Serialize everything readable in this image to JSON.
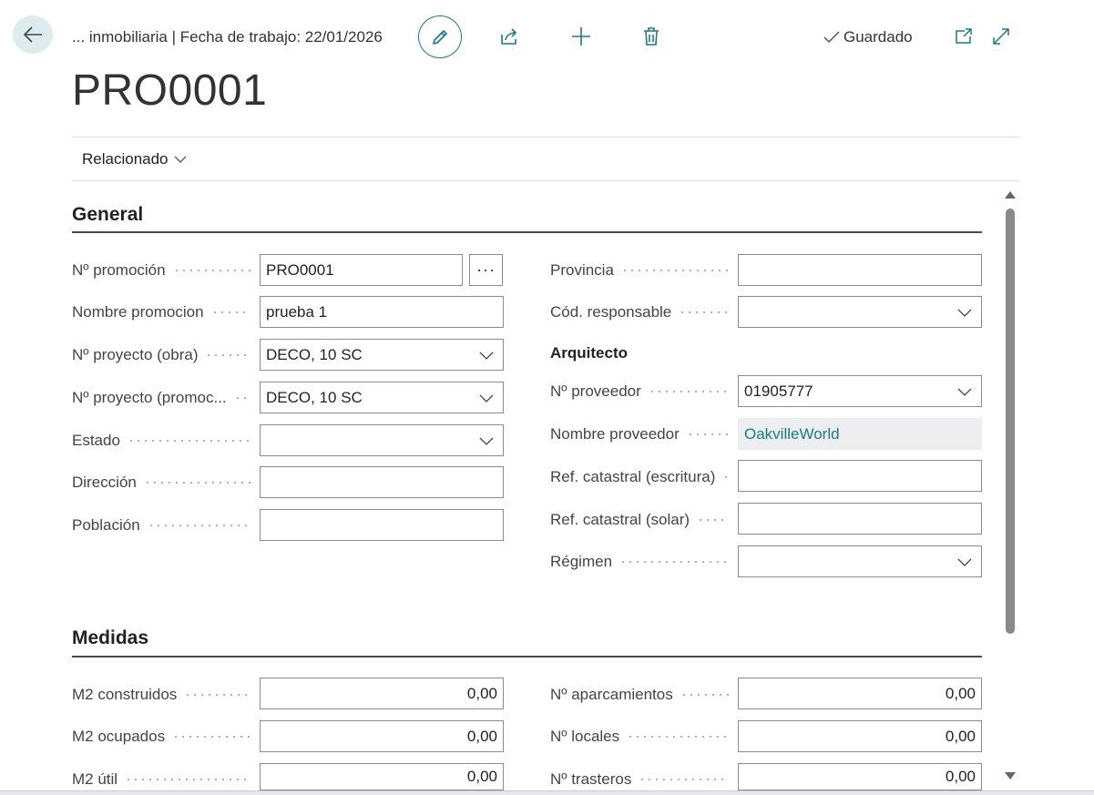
{
  "header": {
    "breadcrumb": "... inmobiliaria | Fecha de trabajo: 22/01/2026",
    "saved_status": "Guardado",
    "title": "PRO0001"
  },
  "nav": {
    "related_label": "Relacionado"
  },
  "sections": {
    "general": "General",
    "measures": "Medidas"
  },
  "general": {
    "left": [
      {
        "label": "Nº promoción",
        "value": "PRO0001"
      },
      {
        "label": "Nombre promocion",
        "value": "prueba 1"
      },
      {
        "label": "Nº proyecto (obra)",
        "value": "DECO, 10 SC"
      },
      {
        "label": "Nº proyecto (promoc...",
        "value": "DECO, 10 SC"
      },
      {
        "label": "Estado",
        "value": ""
      },
      {
        "label": "Dirección",
        "value": ""
      },
      {
        "label": "Población",
        "value": ""
      }
    ],
    "right": [
      {
        "label": "Provincia",
        "value": ""
      },
      {
        "label": "Cód. responsable",
        "value": ""
      },
      {
        "label": "Nº proveedor",
        "value": "01905777"
      },
      {
        "label": "Nombre proveedor",
        "value": "OakvilleWorld"
      },
      {
        "label": "Ref. catastral (escritura)",
        "value": ""
      },
      {
        "label": "Ref. catastral (solar)",
        "value": ""
      },
      {
        "label": "Régimen",
        "value": ""
      }
    ],
    "architect_heading": "Arquitecto",
    "ellipsis": "···"
  },
  "measures": {
    "left": [
      {
        "label": "M2 construidos",
        "value": "0,00"
      },
      {
        "label": "M2 ocupados",
        "value": "0,00"
      },
      {
        "label": "M2 útil",
        "value": "0,00"
      }
    ],
    "right": [
      {
        "label": "Nº aparcamientos",
        "value": "0,00"
      },
      {
        "label": "Nº locales",
        "value": "0,00"
      },
      {
        "label": "Nº trasteros",
        "value": "0,00"
      }
    ]
  },
  "colors": {
    "accent": "#1b7a86",
    "back_bg": "#dcecef"
  }
}
